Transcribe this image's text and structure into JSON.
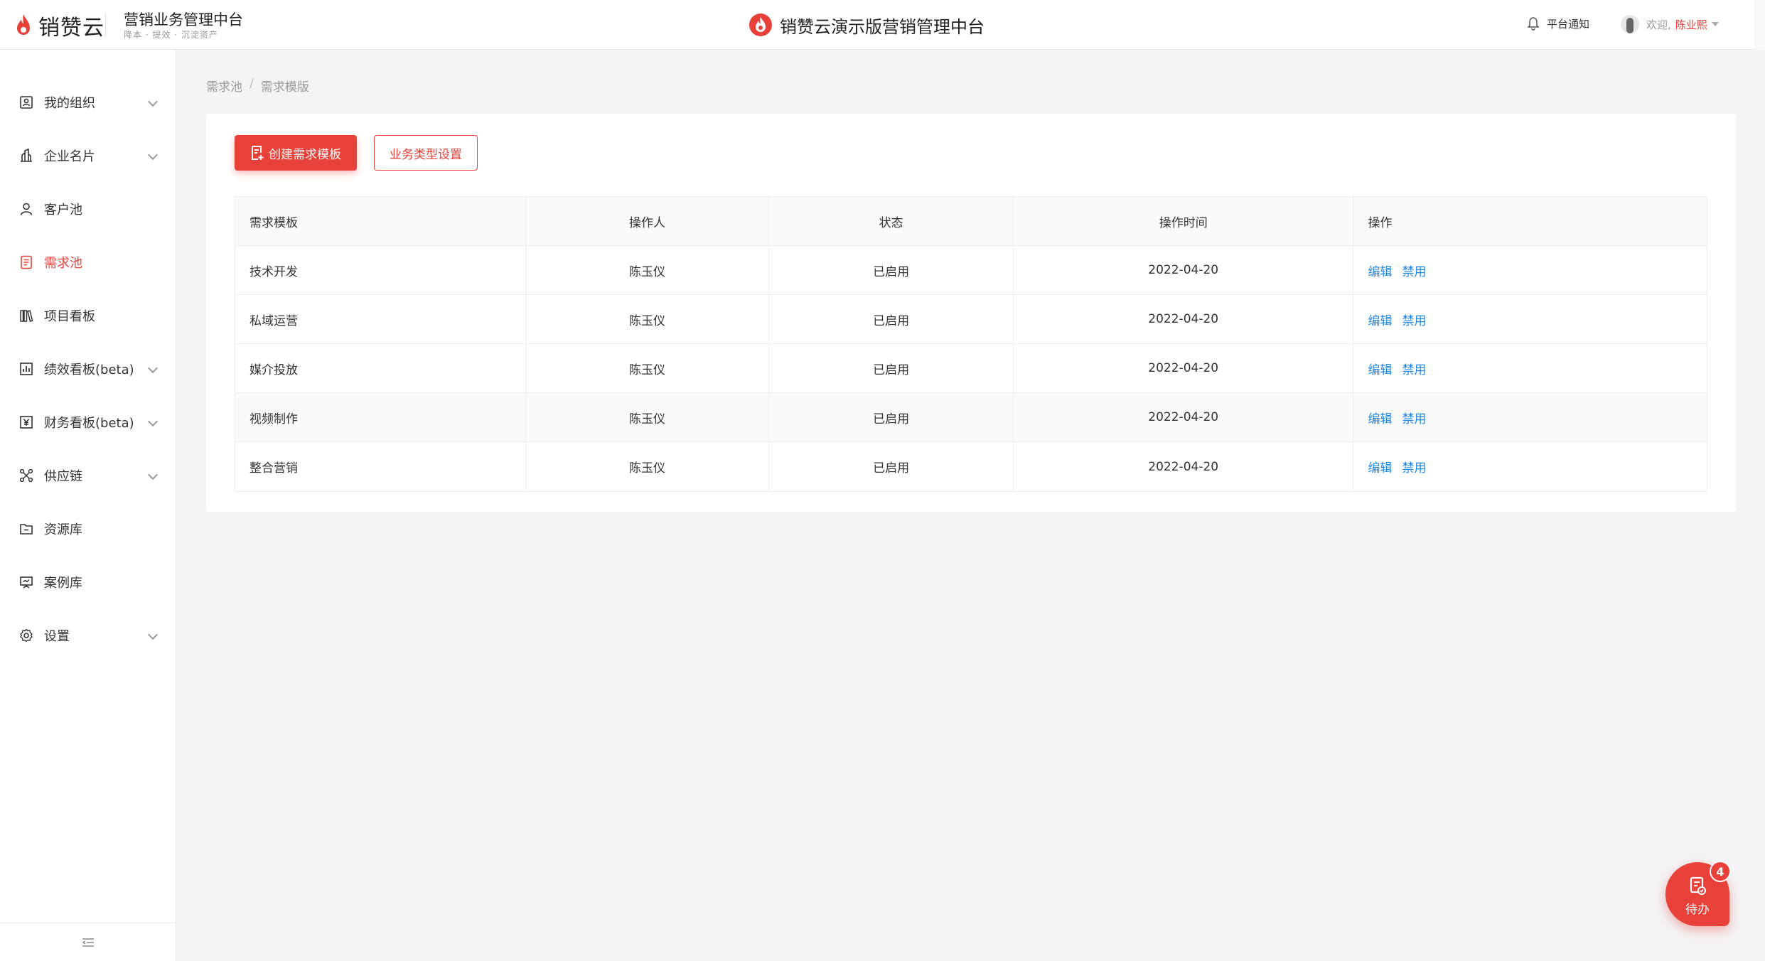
{
  "header": {
    "logo_text": "销赞云",
    "system_title": "营销业务管理中台",
    "system_subtitle": "降本 · 提效 · 沉淀资产",
    "center_title": "销赞云演示版营销管理中台",
    "notice_label": "平台通知",
    "welcome_text": "欢迎,",
    "user_name": "陈业熙"
  },
  "sidebar": {
    "items": [
      {
        "label": "我的组织",
        "icon": "org-icon",
        "has_children": true,
        "active": false
      },
      {
        "label": "企业名片",
        "icon": "building-icon",
        "has_children": true,
        "active": false
      },
      {
        "label": "客户池",
        "icon": "user-icon",
        "has_children": false,
        "active": false
      },
      {
        "label": "需求池",
        "icon": "document-icon",
        "has_children": false,
        "active": true
      },
      {
        "label": "项目看板",
        "icon": "books-icon",
        "has_children": false,
        "active": false
      },
      {
        "label": "绩效看板(beta)",
        "icon": "bar-chart-icon",
        "has_children": true,
        "active": false
      },
      {
        "label": "财务看板(beta)",
        "icon": "yen-icon",
        "has_children": true,
        "active": false
      },
      {
        "label": "供应链",
        "icon": "network-icon",
        "has_children": true,
        "active": false
      },
      {
        "label": "资源库",
        "icon": "folder-icon",
        "has_children": false,
        "active": false
      },
      {
        "label": "案例库",
        "icon": "presentation-icon",
        "has_children": false,
        "active": false
      },
      {
        "label": "设置",
        "icon": "gear-icon",
        "has_children": true,
        "active": false
      }
    ]
  },
  "breadcrumb": {
    "items": [
      "需求池",
      "需求模版"
    ],
    "separator": "/"
  },
  "toolbar": {
    "create_label": "创建需求模板",
    "type_settings_label": "业务类型设置"
  },
  "table": {
    "columns": [
      "需求模板",
      "操作人",
      "状态",
      "操作时间",
      "操作"
    ],
    "rows": [
      {
        "name": "技术开发",
        "operator": "陈玉仪",
        "status": "已启用",
        "time": "2022-04-20",
        "edit": "编辑",
        "disable": "禁用"
      },
      {
        "name": "私域运营",
        "operator": "陈玉仪",
        "status": "已启用",
        "time": "2022-04-20",
        "edit": "编辑",
        "disable": "禁用"
      },
      {
        "name": "媒介投放",
        "operator": "陈玉仪",
        "status": "已启用",
        "time": "2022-04-20",
        "edit": "编辑",
        "disable": "禁用"
      },
      {
        "name": "视频制作",
        "operator": "陈玉仪",
        "status": "已启用",
        "time": "2022-04-20",
        "edit": "编辑",
        "disable": "禁用"
      },
      {
        "name": "整合营销",
        "operator": "陈玉仪",
        "status": "已启用",
        "time": "2022-04-20",
        "edit": "编辑",
        "disable": "禁用"
      }
    ]
  },
  "todo": {
    "label": "待办",
    "badge": "4"
  },
  "colors": {
    "accent": "#e8413a",
    "link": "#1e88e5",
    "background": "#f4f4f6"
  }
}
